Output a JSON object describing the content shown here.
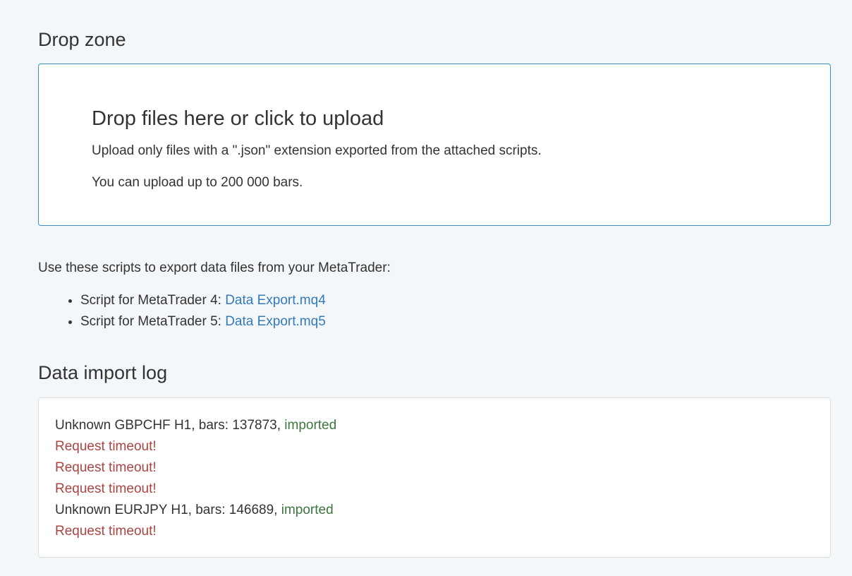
{
  "drop_zone": {
    "section_title": "Drop zone",
    "heading": "Drop files here or click to upload",
    "line1": "Upload only files with a \".json\" extension exported from the attached scripts.",
    "line2": "You can upload up to 200 000 bars."
  },
  "scripts": {
    "intro": "Use these scripts to export data files from your MetaTrader:",
    "items": [
      {
        "label": "Script for MetaTrader 4: ",
        "link_text": "Data Export.mq4"
      },
      {
        "label": "Script for MetaTrader 5: ",
        "link_text": "Data Export.mq5"
      }
    ]
  },
  "import_log": {
    "section_title": "Data import log",
    "entries": [
      {
        "text": "Unknown GBPCHF H1, bars: 137873, ",
        "status": "imported"
      },
      {
        "error": "Request timeout!"
      },
      {
        "error": "Request timeout!"
      },
      {
        "error": "Request timeout!"
      },
      {
        "text": "Unknown EURJPY H1, bars: 146689, ",
        "status": "imported"
      },
      {
        "error": "Request timeout!"
      }
    ]
  },
  "colors": {
    "link": "#337ab7",
    "success": "#3c763d",
    "error": "#a94442",
    "dropzone_border": "#3a8fc3"
  }
}
